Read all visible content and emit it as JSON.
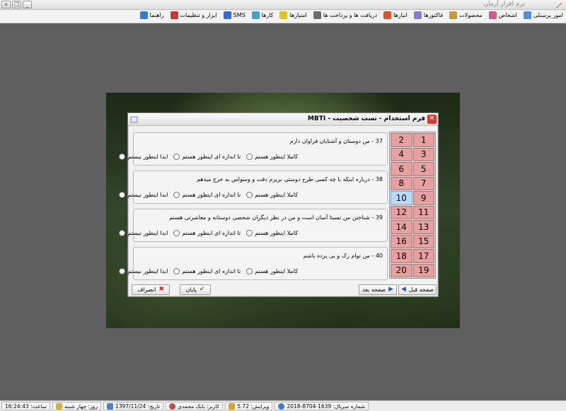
{
  "app": {
    "title": "نرم افزار آرمان"
  },
  "menu": [
    {
      "label": "امور پرسنلی",
      "icon": "personnel-icon",
      "color": "#5a8ed0"
    },
    {
      "label": "اشخاص",
      "icon": "people-icon",
      "color": "#d05a8a"
    },
    {
      "label": "محصولات",
      "icon": "products-icon",
      "color": "#c49a3a"
    },
    {
      "label": "فاکتورها",
      "icon": "invoice-icon",
      "color": "#8a7ad0"
    },
    {
      "label": "انبارها",
      "icon": "warehouse-icon",
      "color": "#c85a3a"
    },
    {
      "label": "دریافت ها و پرداخت ها",
      "icon": "payment-icon",
      "color": "#6b6b6b"
    },
    {
      "label": "امتیازها",
      "icon": "star-icon",
      "color": "#e8c21a"
    },
    {
      "label": "کارها",
      "icon": "tasks-icon",
      "color": "#4aa0c8"
    },
    {
      "label": "SMS",
      "icon": "sms-icon",
      "color": "#3a6ac8"
    },
    {
      "label": "ابزار و تنظیمات",
      "icon": "settings-icon",
      "color": "#c83a3a"
    },
    {
      "label": "راهنما",
      "icon": "help-icon",
      "color": "#3a7ac8"
    }
  ],
  "dialog": {
    "title": "فرم استخدام - تست شخصیت - MBTI",
    "questions": [
      {
        "text": "37 - من دوستان و آشنایان فراوان دارم",
        "options": [
          "ابدا اینطور نیستم",
          "تا اندازه ای اینطور هستم",
          "کاملا اینطور هستم"
        ]
      },
      {
        "text": "38 - درباره اینکه با چه کسی طرح دوستی بریزم دقت و وسواس به خرج میدهم",
        "options": [
          "ابدا اینطور نیستم",
          "تا اندازه ای اینطور هستم",
          "کاملا اینطور هستم"
        ]
      },
      {
        "text": "39 - شناختن من نسبتا آسان است و من در نظر دیگران شخصی دوستانه و معاشرتی هستم",
        "options": [
          "ابدا اینطور نیستم",
          "تا اندازه ای اینطور هستم",
          "کاملا اینطور هستم"
        ]
      },
      {
        "text": "40 - من توام رک و بی پرده باشم",
        "options": [
          "ابدا اینطور نیستم",
          "تا اندازه ای اینطور هستم",
          "کاملا اینطور هستم"
        ]
      }
    ],
    "pages": [
      "1",
      "2",
      "3",
      "4",
      "5",
      "6",
      "7",
      "8",
      "9",
      "10",
      "11",
      "12",
      "13",
      "14",
      "15",
      "16",
      "17",
      "18",
      "19",
      "20"
    ],
    "active_page": "10",
    "buttons": {
      "prev": "صفحه قبل",
      "next": "صفحه بعد",
      "finish": "پایان",
      "cancel": "انصراف"
    },
    "colors": {
      "cell": "#e6a0a0",
      "active_cell": "#bcd8f2"
    }
  },
  "status": {
    "serial": "شماره سریال: 1639-8704-2018",
    "version": "ویرایش: 5.72",
    "user": "کاربر: بابک محمدی",
    "date": "تاریخ: 1397/11/24",
    "day": "روز: چهار شنبه",
    "time": "ساعت: 16:24:43"
  }
}
